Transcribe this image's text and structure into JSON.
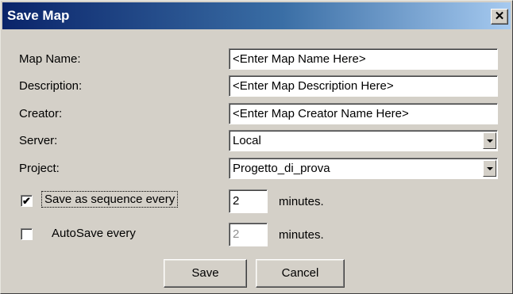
{
  "window": {
    "title": "Save Map",
    "close_label": "✕",
    "colors": {
      "titlebar_start": "#0a246a",
      "titlebar_end": "#a6caf0",
      "face": "#d4d0c8"
    }
  },
  "form": {
    "map_name": {
      "label": "Map Name:",
      "value": "<Enter Map Name Here>"
    },
    "description": {
      "label": "Description:",
      "value": "<Enter Map Description Here>"
    },
    "creator": {
      "label": "Creator:",
      "value": "<Enter Map Creator Name Here>"
    },
    "server": {
      "label": "Server:",
      "value": "Local"
    },
    "project": {
      "label": "Project:",
      "value": "Progetto_di_prova"
    }
  },
  "sequence": {
    "checked": true,
    "check_glyph": "✔",
    "label": "Save as sequence every",
    "value": "2",
    "units": "minutes."
  },
  "autosave": {
    "checked": false,
    "check_glyph": "",
    "label": "AutoSave every",
    "value": "2",
    "units": "minutes."
  },
  "buttons": {
    "save": "Save",
    "cancel": "Cancel"
  }
}
